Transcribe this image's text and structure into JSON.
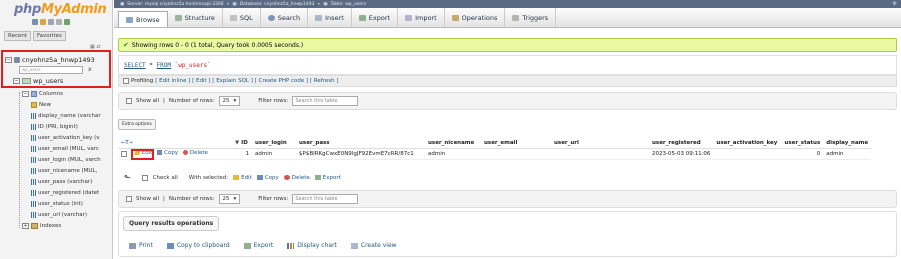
{
  "sidebar": {
    "logo_php": "php",
    "logo_my": "MyAdmin",
    "recent_tab": "Recent",
    "favorites_tab": "Favorites",
    "database": "cnyohnz5a_hnwp1493",
    "filter_placeholder": "wp_users",
    "filter_clear": "x",
    "table": "wp_users",
    "columns_label": "Columns",
    "new_label": "New",
    "columns": [
      "display_name (varchar",
      "ID (PRI, bigint)",
      "user_activation_key (v",
      "user_email (MUL, varc",
      "user_login (MUL, varch",
      "user_nicename (MUL,",
      "user_pass (varchar)",
      "user_registered (datet",
      "user_status (int)",
      "user_url (varchar)"
    ],
    "indexes_label": "Indexes"
  },
  "topbar": {
    "server": "Server: mysql.cnyohnz5a.hnnhmsapi:3306",
    "database": "Database: cnyohnz5a_hnwp1493",
    "table": "Table: wp_users"
  },
  "tabs": [
    {
      "label": "Browse",
      "icon": "browse-icon",
      "active": true
    },
    {
      "label": "Structure",
      "icon": "structure-icon"
    },
    {
      "label": "SQL",
      "icon": "sql-icon"
    },
    {
      "label": "Search",
      "icon": "search-icon"
    },
    {
      "label": "Insert",
      "icon": "insert-icon"
    },
    {
      "label": "Export",
      "icon": "export-icon"
    },
    {
      "label": "Import",
      "icon": "import-icon"
    },
    {
      "label": "Operations",
      "icon": "operations-icon"
    },
    {
      "label": "Triggers",
      "icon": "triggers-icon"
    }
  ],
  "message": "Showing rows 0 - 0 (1 total, Query took 0.0005 seconds.)",
  "sql": {
    "select": "SELECT",
    "star": " * ",
    "from": "FROM",
    "table": " `wp_users`"
  },
  "profiling": {
    "label": "Profiling",
    "links": "[ Edit inline ] [ Edit ] [ Explain SQL ] [ Create PHP code ] [ Refresh ]"
  },
  "nav": {
    "show_all": "Show all",
    "rows_label": "Number of rows:",
    "rows_value": "25",
    "filter_label": "Filter rows:",
    "filter_placeholder": "Search this table"
  },
  "extra_options": "Extra options",
  "table": {
    "arrows": "←T→",
    "sort_marker": "▼",
    "columns": [
      "ID",
      "user_login",
      "user_pass",
      "user_nicename",
      "user_email",
      "user_url",
      "user_registered",
      "user_activation_key",
      "user_status",
      "display_name"
    ],
    "rows": [
      {
        "actions": {
          "edit": "Edit",
          "copy": "Copy",
          "delete": "Delete"
        },
        "cells": [
          "1",
          "admin",
          "$P$BIRKgCwxE0N9lgJF92EvmE7cRR/87c1",
          "admin",
          "",
          "",
          "2023-05-03 09:11:06",
          "",
          "0",
          "admin"
        ]
      }
    ]
  },
  "with_selected": {
    "check_all": "Check all",
    "label": "With selected:",
    "edit": "Edit",
    "copy": "Copy",
    "delete": "Delete",
    "export": "Export"
  },
  "query_ops": {
    "title": "Query results operations",
    "print": "Print",
    "copy": "Copy to clipboard",
    "export": "Export",
    "chart": "Display chart",
    "view": "Create view"
  }
}
